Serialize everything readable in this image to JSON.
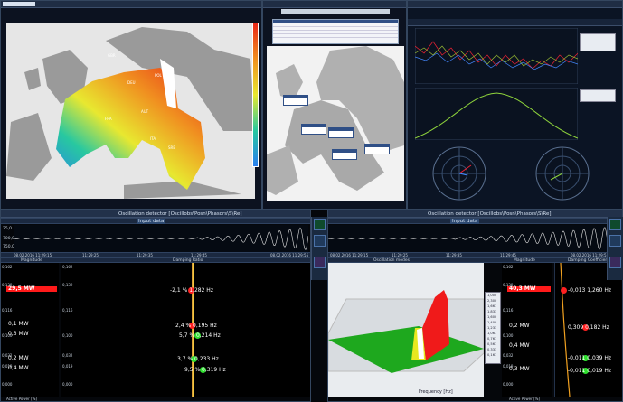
{
  "osc_title": "Oscillation detector [Oscillobs\\Posn\\Phasors\\S\\Re]",
  "input_data": "Input data",
  "ticks_left": [
    "25,0",
    "700,0",
    "750,0"
  ],
  "time_left": [
    "08.02.2016 11:29:15",
    "11:29:25",
    "11:29:35",
    "11:29:45",
    "08.02.2016 11:29:55"
  ],
  "time_right": [
    "08.02.2016 11:29:15",
    "11:29:25",
    "11:29:35",
    "11:29:45",
    "08.02.2016 11:29:55"
  ],
  "left": {
    "magnitude_header": "Magnitude",
    "damping_header": "Damping Ratio",
    "mag_axis": [
      "0,162",
      "0,139",
      "0,116",
      "0,100",
      "0,032",
      "0,019",
      "0,000"
    ],
    "damp_axis": [
      "0,162",
      "0,139",
      "0,116",
      "0,100",
      "0,032",
      "0,019",
      "0,000"
    ],
    "mag_items": [
      {
        "label": "29,5 MW",
        "highlight": true
      },
      {
        "label": "0,1 MW"
      },
      {
        "label": "0,3 MW"
      },
      {
        "label": "0,2 MW"
      },
      {
        "label": "0,4 MW"
      }
    ],
    "modes": [
      {
        "text": "-2,1 %  1,282 Hz",
        "color": "#ff2020"
      },
      {
        "text": "2,4 %  0,195 Hz",
        "color": "#ff2020"
      },
      {
        "text": "5,7 %  0,214 Hz",
        "color": "#30e030"
      },
      {
        "text": "3,7 %  0,233 Hz",
        "color": "#30e030"
      },
      {
        "text": "9,5 %  0,319 Hz",
        "color": "#30e030"
      }
    ],
    "x_axis_label": "Active Power [%]"
  },
  "right": {
    "modes_header": "Oscillation modes",
    "magnitude_header": "Magnitude",
    "damping_header": "Damping Coefficient",
    "mag_axis": [
      "0,162",
      "0,139",
      "0,116",
      "0,100",
      "0,032",
      "0,019",
      "0,000"
    ],
    "mag_items": [
      {
        "label": "40,3 MW",
        "highlight": true
      },
      {
        "label": "0,2 MW"
      },
      {
        "label": "0,4 MW"
      },
      {
        "label": "0,3 MW"
      }
    ],
    "modes": [
      {
        "text": "-0,013  1,260 Hz",
        "color": "#ff2020"
      },
      {
        "text": "0,309  0,182 Hz",
        "color": "#ff2020"
      },
      {
        "text": "-0,011  0,039 Hz",
        "color": "#30e030"
      },
      {
        "text": "-0,011  0,019 Hz",
        "color": "#30e030"
      }
    ],
    "legend": [
      "1,000",
      "2,300",
      "1,667",
      "1,833",
      "1,600",
      "1,400",
      "1,233",
      "1,067",
      "0,767",
      "0,567",
      "0,333",
      "0,167"
    ],
    "freq_label": "Frequency [Hz]",
    "x_axis_label": "Active Power [%]"
  },
  "map_labels": [
    "GBR",
    "NLD",
    "BEL",
    "DEU",
    "POL",
    "FRA",
    "AUT",
    "SVN",
    "HRV",
    "ESP",
    "ITA",
    "HUN",
    "SRB",
    "GRC"
  ],
  "pmu_boxes": [
    "PMU 1",
    "PMU 2",
    "PMU 3",
    "PMU 4",
    "PMU 5"
  ]
}
